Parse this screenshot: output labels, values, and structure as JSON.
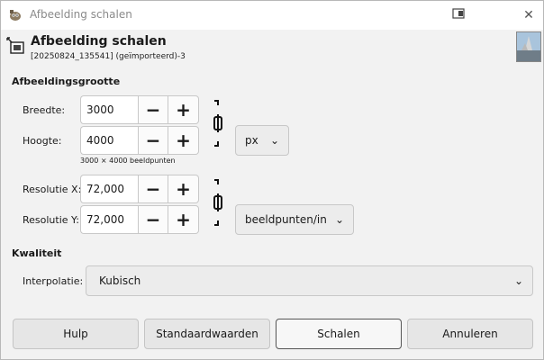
{
  "window": {
    "title": "Afbeelding schalen",
    "header_title": "Afbeelding schalen",
    "header_subtitle": "[20250824_135541] (geïmporteerd)-3"
  },
  "sections": {
    "image_size": "Afbeeldingsgrootte",
    "quality": "Kwaliteit"
  },
  "fields": {
    "width_label": "Breedte:",
    "width_value": "3000",
    "height_label": "Hoogte:",
    "height_value": "4000",
    "size_unit": "px",
    "size_info": "3000 × 4000 beeldpunten",
    "res_x_label": "Resolutie X:",
    "res_x_value": "72,000",
    "res_y_label": "Resolutie Y:",
    "res_y_value": "72,000",
    "res_unit": "beeldpunten/in",
    "interpolation_label": "Interpolatie:",
    "interpolation_value": "Kubisch"
  },
  "glyphs": {
    "minus": "−",
    "plus": "+",
    "chevron": "⌄",
    "close": "✕"
  },
  "buttons": {
    "help": "Hulp",
    "defaults": "Standaardwaarden",
    "scale": "Schalen",
    "cancel": "Annuleren"
  },
  "icons": [
    "gimp-icon",
    "window-mode-icon",
    "close-icon",
    "scale-image-icon",
    "image-thumbnail",
    "chain-link-icon"
  ]
}
